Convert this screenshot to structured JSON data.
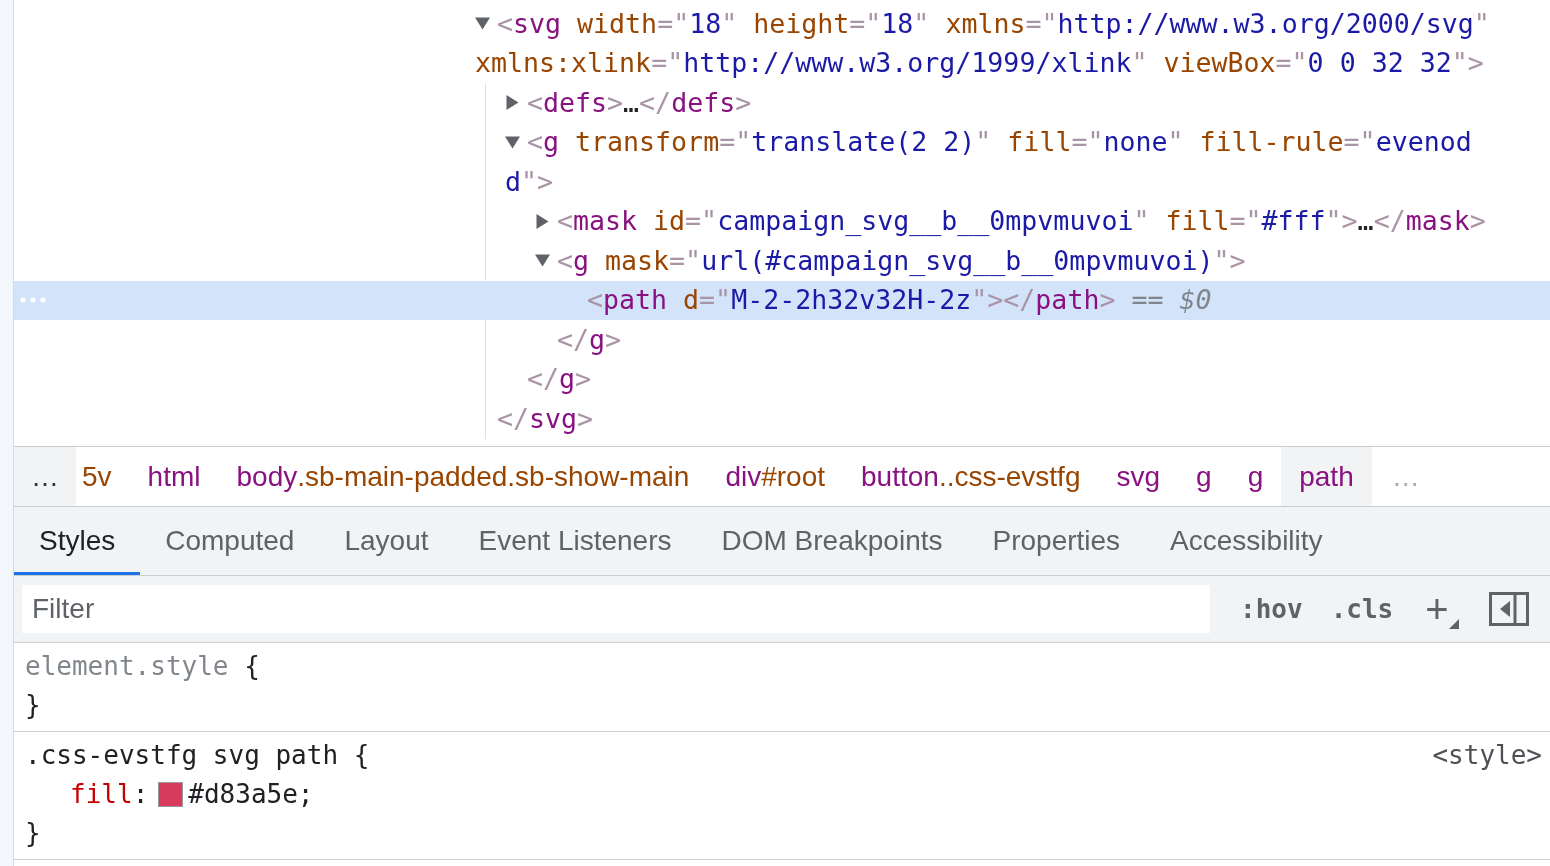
{
  "elements_tree": {
    "nodes": [
      {
        "expanded": true,
        "open": [
          [
            {
              "kind": "p",
              "text": "<"
            },
            {
              "kind": "tag",
              "text": "svg"
            },
            {
              "kind": "attr",
              "text": " width"
            },
            {
              "kind": "p",
              "text": "=\""
            },
            {
              "kind": "val",
              "text": "18"
            },
            {
              "kind": "p",
              "text": "\""
            },
            {
              "kind": "attr",
              "text": " height"
            },
            {
              "kind": "p",
              "text": "=\""
            },
            {
              "kind": "val",
              "text": "18"
            },
            {
              "kind": "p",
              "text": "\""
            },
            {
              "kind": "attr",
              "text": " xmlns"
            },
            {
              "kind": "p",
              "text": "=\""
            },
            {
              "kind": "val",
              "text": "http://www.w3.org/2000/svg"
            },
            {
              "kind": "p",
              "text": "\""
            }
          ],
          [
            {
              "kind": "attr",
              "text": "xmlns:xlink"
            },
            {
              "kind": "p",
              "text": "=\""
            },
            {
              "kind": "val",
              "text": "http://www.w3.org/1999/xlink"
            },
            {
              "kind": "p",
              "text": "\""
            },
            {
              "kind": "attr",
              "text": " viewBox"
            },
            {
              "kind": "p",
              "text": "=\""
            },
            {
              "kind": "val",
              "text": "0 0 32 32"
            },
            {
              "kind": "p",
              "text": "\">"
            }
          ]
        ],
        "children": [
          {
            "expanded": false,
            "open": [
              [
                {
                  "kind": "p",
                  "text": "<"
                },
                {
                  "kind": "tag",
                  "text": "defs"
                },
                {
                  "kind": "p",
                  "text": ">"
                },
                {
                  "kind": "plain",
                  "text": "…"
                },
                {
                  "kind": "p",
                  "text": "</"
                },
                {
                  "kind": "tag",
                  "text": "defs"
                },
                {
                  "kind": "p",
                  "text": ">"
                }
              ]
            ]
          },
          {
            "expanded": true,
            "open": [
              [
                {
                  "kind": "p",
                  "text": "<"
                },
                {
                  "kind": "tag",
                  "text": "g"
                },
                {
                  "kind": "attr",
                  "text": " transform"
                },
                {
                  "kind": "p",
                  "text": "=\""
                },
                {
                  "kind": "val",
                  "text": "translate(2 2)"
                },
                {
                  "kind": "p",
                  "text": "\""
                },
                {
                  "kind": "attr",
                  "text": " fill"
                },
                {
                  "kind": "p",
                  "text": "=\""
                },
                {
                  "kind": "val",
                  "text": "none"
                },
                {
                  "kind": "p",
                  "text": "\""
                },
                {
                  "kind": "attr",
                  "text": " fill-rule"
                },
                {
                  "kind": "p",
                  "text": "=\""
                },
                {
                  "kind": "val",
                  "text": "evenod"
                }
              ],
              [
                {
                  "kind": "val",
                  "text": "d"
                },
                {
                  "kind": "p",
                  "text": "\">"
                }
              ]
            ],
            "children": [
              {
                "expanded": false,
                "open": [
                  [
                    {
                      "kind": "p",
                      "text": "<"
                    },
                    {
                      "kind": "tag",
                      "text": "mask"
                    },
                    {
                      "kind": "attr",
                      "text": " id"
                    },
                    {
                      "kind": "p",
                      "text": "=\""
                    },
                    {
                      "kind": "val",
                      "text": "campaign_svg__b__0mpvmuvoi"
                    },
                    {
                      "kind": "p",
                      "text": "\""
                    },
                    {
                      "kind": "attr",
                      "text": " fill"
                    },
                    {
                      "kind": "p",
                      "text": "=\""
                    },
                    {
                      "kind": "val",
                      "text": "#fff"
                    },
                    {
                      "kind": "p",
                      "text": "\">"
                    },
                    {
                      "kind": "plain",
                      "text": "…"
                    },
                    {
                      "kind": "p",
                      "text": "</"
                    },
                    {
                      "kind": "tag",
                      "text": "mask"
                    },
                    {
                      "kind": "p",
                      "text": ">"
                    }
                  ]
                ]
              },
              {
                "expanded": true,
                "open": [
                  [
                    {
                      "kind": "p",
                      "text": "<"
                    },
                    {
                      "kind": "tag",
                      "text": "g"
                    },
                    {
                      "kind": "attr",
                      "text": " mask"
                    },
                    {
                      "kind": "p",
                      "text": "=\""
                    },
                    {
                      "kind": "val",
                      "text": "url(#campaign_svg__b__0mpvmuvoi)"
                    },
                    {
                      "kind": "p",
                      "text": "\">"
                    }
                  ]
                ],
                "children": [
                  {
                    "selected": true,
                    "open": [
                      [
                        {
                          "kind": "p",
                          "text": "<"
                        },
                        {
                          "kind": "tag",
                          "text": "path"
                        },
                        {
                          "kind": "attr",
                          "text": " d"
                        },
                        {
                          "kind": "p",
                          "text": "=\""
                        },
                        {
                          "kind": "val",
                          "text": "M-2-2h32v32H-2z"
                        },
                        {
                          "kind": "p",
                          "text": "\">"
                        },
                        {
                          "kind": "p",
                          "text": "</"
                        },
                        {
                          "kind": "tag",
                          "text": "path"
                        },
                        {
                          "kind": "p",
                          "text": ">"
                        },
                        {
                          "kind": "note",
                          "text": " == "
                        },
                        {
                          "kind": "var",
                          "text": "$0"
                        }
                      ]
                    ]
                  }
                ],
                "close": [
                  {
                    "kind": "p",
                    "text": "</"
                  },
                  {
                    "kind": "tag",
                    "text": "g"
                  },
                  {
                    "kind": "p",
                    "text": ">"
                  }
                ]
              }
            ],
            "close": [
              {
                "kind": "p",
                "text": "</"
              },
              {
                "kind": "tag",
                "text": "g"
              },
              {
                "kind": "p",
                "text": ">"
              }
            ]
          }
        ],
        "close": [
          {
            "kind": "p",
            "text": "</"
          },
          {
            "kind": "tag",
            "text": "svg"
          },
          {
            "kind": "p",
            "text": ">"
          }
        ]
      }
    ]
  },
  "breadcrumbs": {
    "scroll_left": "…",
    "scroll_right": "…",
    "items": [
      {
        "suffix": "5v",
        "selected": false
      },
      {
        "tag": "html",
        "selected": false
      },
      {
        "tag": "body",
        "suffix": ".sb-main-padded.sb-show-main",
        "selected": false
      },
      {
        "tag": "div",
        "suffix": "#root",
        "selected": false
      },
      {
        "tag": "button",
        "suffix": "..css-evstfg",
        "selected": false
      },
      {
        "tag": "svg",
        "selected": false
      },
      {
        "tag": "g",
        "selected": false
      },
      {
        "tag": "g",
        "selected": false
      },
      {
        "tag": "path",
        "selected": true
      }
    ]
  },
  "tabs": [
    {
      "label": "Styles",
      "selected": true
    },
    {
      "label": "Computed",
      "selected": false
    },
    {
      "label": "Layout",
      "selected": false
    },
    {
      "label": "Event Listeners",
      "selected": false
    },
    {
      "label": "DOM Breakpoints",
      "selected": false
    },
    {
      "label": "Properties",
      "selected": false
    },
    {
      "label": "Accessibility",
      "selected": false
    }
  ],
  "filter": {
    "placeholder": "Filter",
    "buttons": [
      ":hov",
      ".cls",
      "+"
    ]
  },
  "rules": [
    {
      "kind": "inline",
      "selector": "element.style",
      "open_brace": " {",
      "close_brace": "}"
    },
    {
      "kind": "stylesheet",
      "selector": ".css-evstfg svg path",
      "open_brace": " {",
      "close_brace": "}",
      "source": "<style>",
      "declarations": [
        {
          "property": "fill",
          "separator": ":",
          "color": "#d83a5e",
          "value": "#d83a5e",
          "terminator": ";"
        }
      ]
    }
  ]
}
